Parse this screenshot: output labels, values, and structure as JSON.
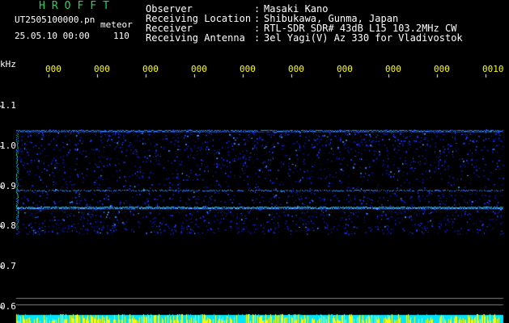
{
  "header": {
    "logo": "HROFFT",
    "filename": "UT2505100000.pn",
    "tag": "meteor",
    "datetime": "25.05.10 00:00",
    "count": "110"
  },
  "info": {
    "labels": [
      "Observer",
      "Receiving Location",
      "Receiver",
      "Receiving Antenna"
    ],
    "values": [
      "Masaki Kano",
      "Shibukawa, Gunma, Japan",
      "RTL-SDR SDR# 43dB L15 103.2MHz CW",
      "3el Yagi(V) Az 330 for Vladivostok"
    ]
  },
  "axis": {
    "unit": "kHz",
    "y_ticks": [
      "1.1",
      "1.0",
      "0.9",
      "0.8",
      "0.7",
      "0.6"
    ],
    "x_ticks": [
      "000",
      "000",
      "000",
      "000",
      "000",
      "000",
      "000",
      "000",
      "000",
      "0010"
    ]
  },
  "colors": {
    "logo": "#1fd65a",
    "text": "#ffffff",
    "xtick": "#ffff00",
    "grid": "#808080",
    "signal": "#00e5ff",
    "noise": "#1a3cff"
  }
}
